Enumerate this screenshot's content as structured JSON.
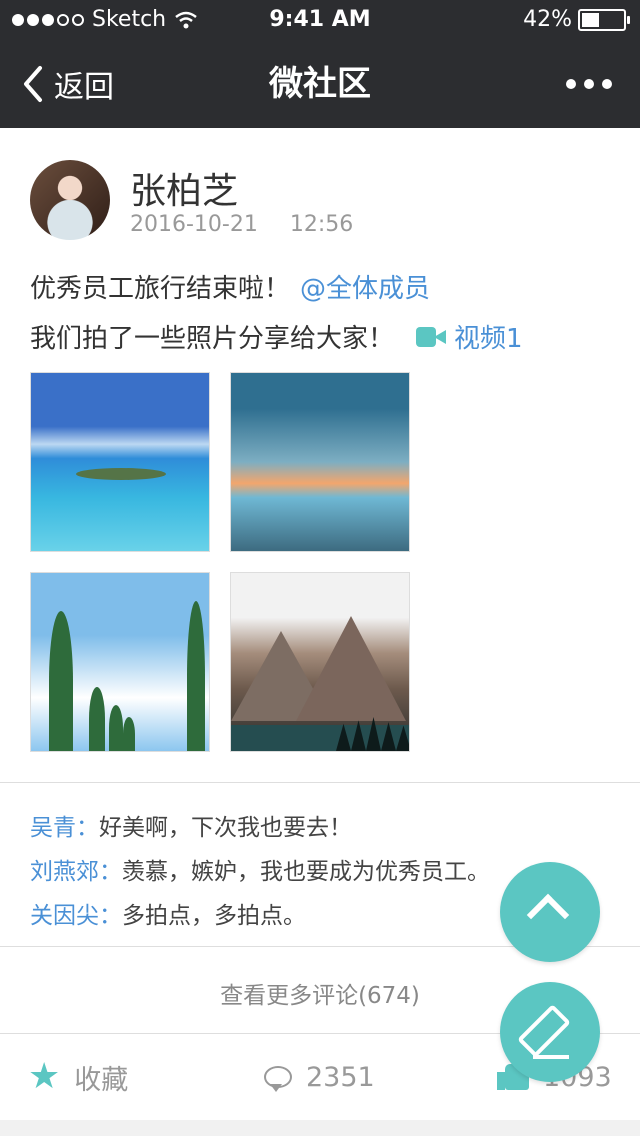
{
  "status_bar": {
    "carrier": "Sketch",
    "time": "9:41 AM",
    "battery": "42%",
    "battery_level": 0.42
  },
  "nav": {
    "back_label": "返回",
    "title": "微社区"
  },
  "post": {
    "author": "张柏芝",
    "date": "2016-10-21",
    "time": "12:56",
    "text_line_1": "优秀员工旅行结束啦！",
    "mention": "@全体成员",
    "text_line_2": "我们拍了一些照片分享给大家！",
    "video_label": "视频1"
  },
  "comments": [
    {
      "name": "吴青：",
      "text": "好美啊，下次我也要去！"
    },
    {
      "name": "刘燕郊：",
      "text": "羡慕，嫉妒，我也要成为优秀员工。"
    },
    {
      "name": "关因尖：",
      "text": "多拍点，多拍点。"
    }
  ],
  "more_comments_label": "查看更多评论(674)",
  "actions": {
    "favorite_label": "收藏",
    "comment_count": "2351",
    "like_count": "1093"
  },
  "colors": {
    "accent": "#5bc6c2",
    "link": "#4a90d6",
    "nav_bg": "#2c2d30"
  },
  "icons": [
    "back-chevron-icon",
    "more-icon",
    "video-icon",
    "star-icon",
    "comment-icon",
    "thumbs-up-icon",
    "up-arrow-icon",
    "edit-icon"
  ]
}
